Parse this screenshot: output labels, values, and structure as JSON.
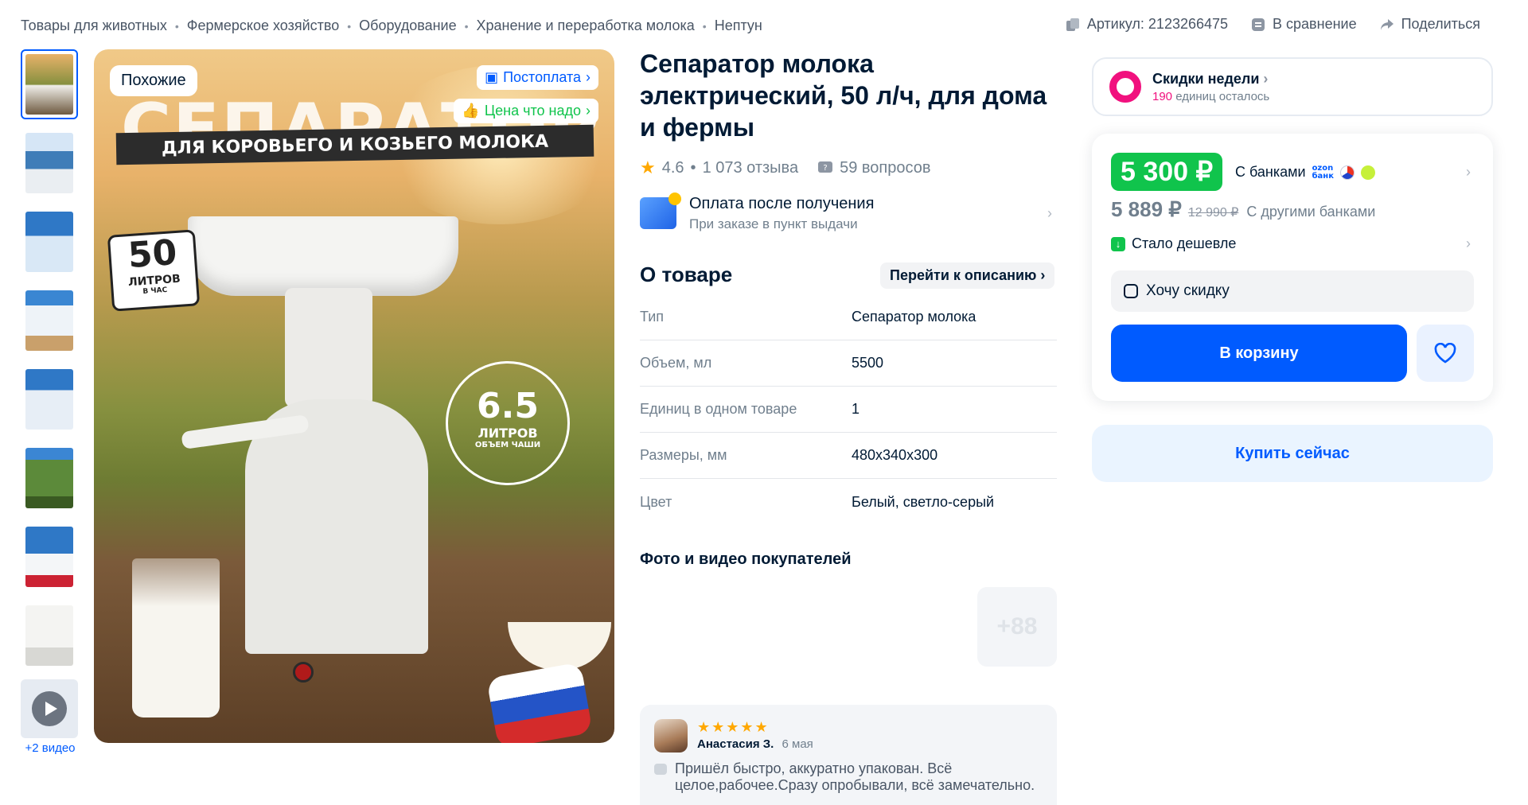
{
  "breadcrumbs": [
    "Товары для животных",
    "Фермерское хозяйство",
    "Оборудование",
    "Хранение и переработка молока",
    "Нептун"
  ],
  "top_actions": {
    "article": "Артикул: 2123266475",
    "compare": "В сравнение",
    "share": "Поделиться"
  },
  "gallery": {
    "video_more": "+2 видео",
    "badge_similar": "Похожие",
    "badge_postpay": "Постоплата",
    "badge_price": "Цена что надо",
    "image_title": "СЕПАРАТОР",
    "image_subtitle": "ДЛЯ КОРОВЬЕГО И КОЗЬЕГО МОЛОКА",
    "stamp_number": "50",
    "stamp_unit": "ЛИТРОВ",
    "stamp_sub": "В ЧАС",
    "circle_number": "6.5",
    "circle_unit": "ЛИТРОВ",
    "circle_sub": "ОБЪЕМ ЧАШИ"
  },
  "product": {
    "title": "Сепаратор молока электрический, 50 л/ч, для дома и фермы",
    "rating": "4.6",
    "reviews": "1 073 отзыва",
    "questions": "59 вопросов",
    "pay_after_title": "Оплата после получения",
    "pay_after_sub": "При заказе в пункт выдачи",
    "about_heading": "О товаре",
    "about_link": "Перейти к описанию",
    "specs": [
      {
        "k": "Тип",
        "v": "Сепаратор молока"
      },
      {
        "k": "Объем, мл",
        "v": "5500"
      },
      {
        "k": "Единиц в одном товаре",
        "v": "1"
      },
      {
        "k": "Размеры, мм",
        "v": "480x340x300"
      },
      {
        "k": "Цвет",
        "v": "Белый, светло-серый"
      }
    ],
    "photos_heading": "Фото и видео покупателей",
    "photos_more": "+88"
  },
  "review": {
    "stars": "★★★★★",
    "author": "Анастасия З.",
    "date": "6 мая",
    "text": "Пришёл быстро, аккуратно упакован. Всё целое,рабочее.Сразу опробывали, всё замечательно."
  },
  "deal": {
    "title": "Скидки недели",
    "count": "190",
    "left": "единиц осталось"
  },
  "price": {
    "main": "5 300 ₽",
    "with_banks": "С банками",
    "bank_label": "ozon банк",
    "other": "5 889 ₽",
    "old": "12 990 ₽",
    "other_label": "С другими банками",
    "cheaper": "Стало дешевле",
    "want_discount": "Хочу скидку",
    "cart": "В корзину",
    "buy_now": "Купить сейчас"
  },
  "colors": {
    "accent": "#005bff",
    "green": "#10c44c",
    "pink": "#f1117e"
  }
}
